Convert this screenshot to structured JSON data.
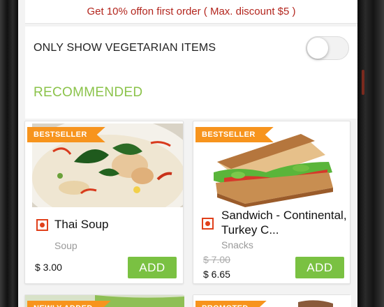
{
  "offer": {
    "text": "Get 10% offon first order ( Max. discount $5 )"
  },
  "veg_filter": {
    "label": "ONLY SHOW VEGETARIAN ITEMS",
    "enabled": false
  },
  "section": {
    "title": "RECOMMENDED"
  },
  "items": [
    {
      "badge": "BESTSELLER",
      "name": "Thai Soup",
      "category": "Soup",
      "old_price": "",
      "price": "$ 3.00",
      "add_label": "ADD"
    },
    {
      "badge": "BESTSELLER",
      "name": "Sandwich - Continental, Turkey C...",
      "category": "Snacks",
      "old_price": "$ 7.00",
      "price": "$ 6.65",
      "add_label": "ADD"
    }
  ],
  "peek_items": [
    {
      "badge": "NEWLY ADDED"
    },
    {
      "badge": "PROMOTED"
    }
  ],
  "colors": {
    "accent_green": "#7ac142",
    "section_green": "#8bc34a",
    "ribbon_orange": "#f7941d",
    "offer_red": "#b3261e",
    "veg_marker": "#e0401b"
  },
  "icons": {
    "veg_marker": "non-veg-dot-icon",
    "toggle": "toggle-switch"
  }
}
